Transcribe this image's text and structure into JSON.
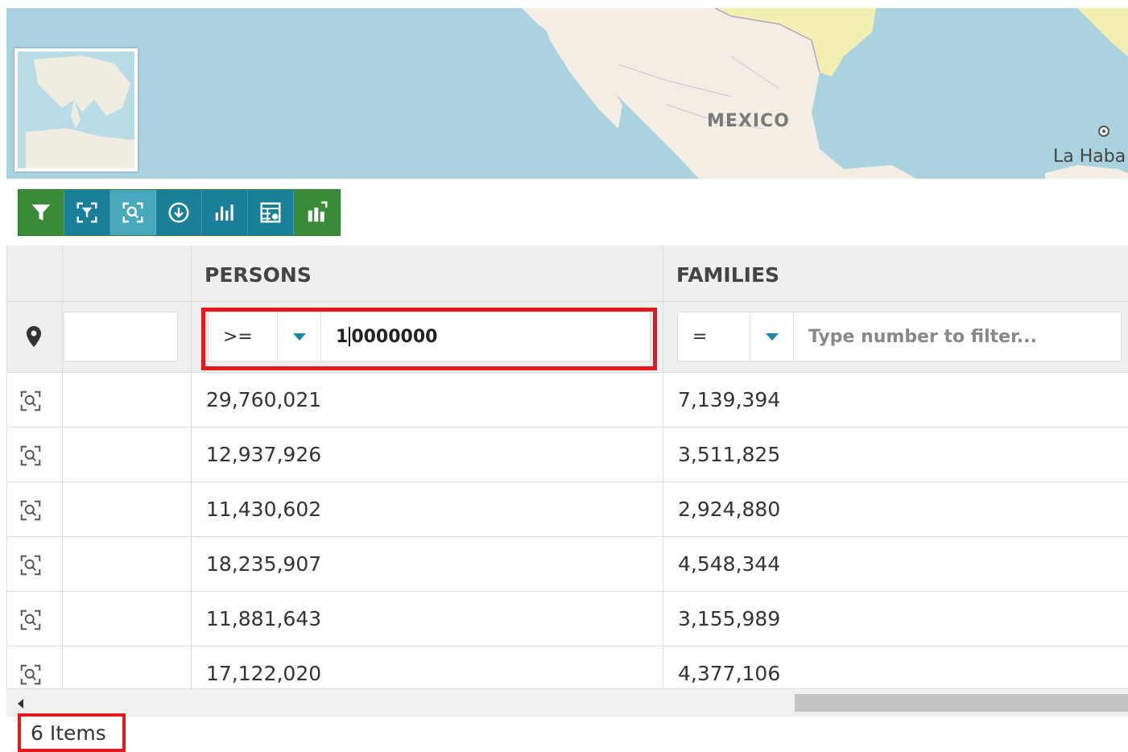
{
  "map": {
    "country_label": "MEXICO",
    "city_label": "La Haba"
  },
  "toolbar": {
    "buttons": [
      {
        "name": "filter-icon",
        "color": "#3a8b38"
      },
      {
        "name": "zoom-to-filter-icon",
        "color": "#1a7f99"
      },
      {
        "name": "zoom-to-selection-icon",
        "color": "#4aa8bd"
      },
      {
        "name": "download-icon",
        "color": "#1a7f99"
      },
      {
        "name": "chart-icon",
        "color": "#1a7f99"
      },
      {
        "name": "table-settings-icon",
        "color": "#1a7f99"
      },
      {
        "name": "widget-chart-icon",
        "color": "#3a8b38"
      }
    ]
  },
  "grid": {
    "columns": [
      {
        "header": ""
      },
      {
        "header": ""
      },
      {
        "header": "PERSONS"
      },
      {
        "header": "FAMILIES"
      }
    ],
    "filters": {
      "persons": {
        "operator": ">=",
        "value_prefix": "1",
        "value_suffix": "0000000"
      },
      "families": {
        "operator": "=",
        "placeholder": "Type number to filter..."
      }
    },
    "rows": [
      {
        "persons": "29,760,021",
        "families": "7,139,394"
      },
      {
        "persons": "12,937,926",
        "families": "3,511,825"
      },
      {
        "persons": "11,430,602",
        "families": "2,924,880"
      },
      {
        "persons": "18,235,907",
        "families": "4,548,344"
      },
      {
        "persons": "11,881,643",
        "families": "3,155,989"
      },
      {
        "persons": "17,122,020",
        "families": "4,377,106"
      }
    ]
  },
  "footer": {
    "item_count": "6 Items"
  },
  "colors": {
    "highlight": "#e3191e",
    "accent": "#1a85a5",
    "toolbar_green": "#3a8b38",
    "toolbar_teal": "#1a7f99"
  }
}
